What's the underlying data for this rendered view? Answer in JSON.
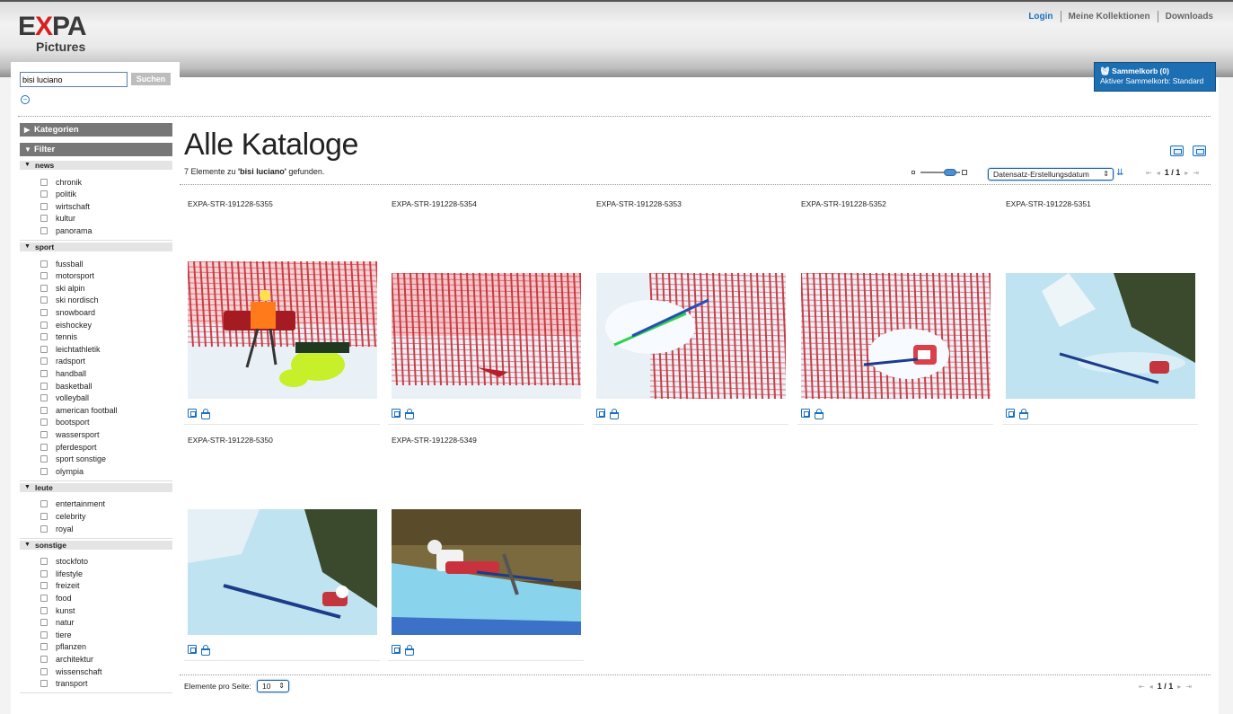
{
  "header": {
    "logo_main": "EXPA",
    "logo_sub": "Pictures",
    "links": [
      "Login",
      "Meine Kollektionen",
      "Downloads"
    ]
  },
  "search": {
    "value": "bisi luciano",
    "button_label": "Suchen"
  },
  "cart": {
    "title": "Sammelkorb (0)",
    "subtitle": "Aktiver Sammelkorb: Standard"
  },
  "sidebar": {
    "categories_label": "Kategorien",
    "filter_label": "Filter",
    "groups": [
      {
        "name": "news",
        "items": [
          "chronik",
          "politik",
          "wirtschaft",
          "kultur",
          "panorama"
        ]
      },
      {
        "name": "sport",
        "items": [
          "fussball",
          "motorsport",
          "ski alpin",
          "ski nordisch",
          "snowboard",
          "eishockey",
          "tennis",
          "leichtathletik",
          "radsport",
          "handball",
          "basketball",
          "volleyball",
          "american football",
          "bootsport",
          "wassersport",
          "pferdesport",
          "sport sonstige",
          "olympia"
        ]
      },
      {
        "name": "leute",
        "items": [
          "entertainment",
          "celebrity",
          "royal"
        ]
      },
      {
        "name": "sonstige",
        "items": [
          "stockfoto",
          "lifestyle",
          "freizeit",
          "food",
          "kunst",
          "natur",
          "tiere",
          "pflanzen",
          "architektur",
          "wissenschaft",
          "transport"
        ]
      }
    ]
  },
  "main": {
    "title": "Alle Kataloge",
    "result_prefix": "7 Elemente zu ",
    "result_query": "'bisi luciano'",
    "result_suffix": " gefunden.",
    "sort_value": "Datensatz-Erstellungsdatum",
    "page_indicator": "1 / 1",
    "per_page_label": "Elemente pro Seite:",
    "per_page_value": "10"
  },
  "results": [
    {
      "id": "EXPA-STR-191228-5355",
      "scene": "rescue"
    },
    {
      "id": "EXPA-STR-191228-5354",
      "scene": "net"
    },
    {
      "id": "EXPA-STR-191228-5353",
      "scene": "skis"
    },
    {
      "id": "EXPA-STR-191228-5352",
      "scene": "crash"
    },
    {
      "id": "EXPA-STR-191228-5351",
      "scene": "slide"
    },
    {
      "id": "EXPA-STR-191228-5350",
      "scene": "slide2"
    },
    {
      "id": "EXPA-STR-191228-5349",
      "scene": "fall"
    }
  ]
}
